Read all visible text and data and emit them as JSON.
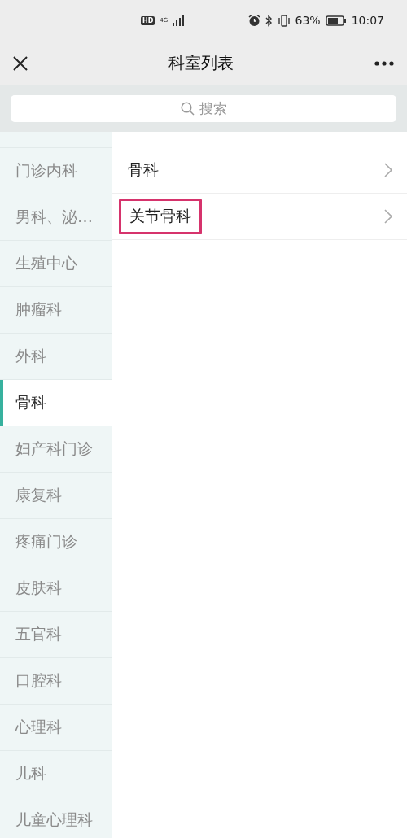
{
  "status_bar": {
    "hd_badge": "HD",
    "network": "4G",
    "battery_percent": "63%",
    "time": "10:07"
  },
  "nav_bar": {
    "title": "科室列表"
  },
  "search": {
    "placeholder": "搜索"
  },
  "departments": [
    {
      "label": "门诊内科",
      "selected": false
    },
    {
      "label": "男科、泌…",
      "selected": false
    },
    {
      "label": "生殖中心",
      "selected": false
    },
    {
      "label": "肿瘤科",
      "selected": false
    },
    {
      "label": "外科",
      "selected": false
    },
    {
      "label": "骨科",
      "selected": true
    },
    {
      "label": "妇产科门诊",
      "selected": false
    },
    {
      "label": "康复科",
      "selected": false
    },
    {
      "label": "疼痛门诊",
      "selected": false
    },
    {
      "label": "皮肤科",
      "selected": false
    },
    {
      "label": "五官科",
      "selected": false
    },
    {
      "label": "口腔科",
      "selected": false
    },
    {
      "label": "心理科",
      "selected": false
    },
    {
      "label": "儿科",
      "selected": false
    },
    {
      "label": "儿童心理科",
      "selected": false
    }
  ],
  "sub_departments": [
    {
      "label": "骨科",
      "highlighted": false
    },
    {
      "label": "关节骨科",
      "highlighted": true
    }
  ]
}
